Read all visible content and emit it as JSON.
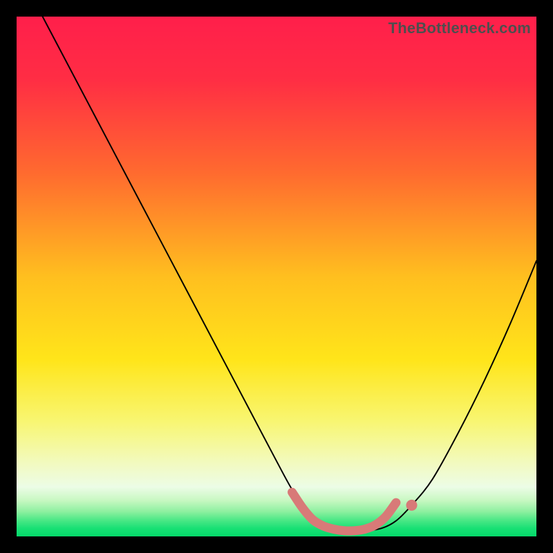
{
  "watermark": "TheBottleneck.com",
  "chart_data": {
    "type": "line",
    "title": "",
    "xlabel": "",
    "ylabel": "",
    "xlim": [
      0,
      100
    ],
    "ylim": [
      0,
      100
    ],
    "gradient_stops": [
      {
        "offset": 0.0,
        "color": "#ff1f4b"
      },
      {
        "offset": 0.12,
        "color": "#ff2d44"
      },
      {
        "offset": 0.3,
        "color": "#ff6a2f"
      },
      {
        "offset": 0.5,
        "color": "#ffbf1f"
      },
      {
        "offset": 0.66,
        "color": "#ffe51a"
      },
      {
        "offset": 0.78,
        "color": "#f8f673"
      },
      {
        "offset": 0.86,
        "color": "#f2fac0"
      },
      {
        "offset": 0.905,
        "color": "#ecfce6"
      },
      {
        "offset": 0.93,
        "color": "#c9f8c3"
      },
      {
        "offset": 0.952,
        "color": "#8ef0a0"
      },
      {
        "offset": 0.968,
        "color": "#4ee887"
      },
      {
        "offset": 0.985,
        "color": "#17e074"
      },
      {
        "offset": 1.0,
        "color": "#05d96a"
      }
    ],
    "series": [
      {
        "name": "bottleneck-curve",
        "x": [
          5,
          10,
          15,
          20,
          25,
          30,
          35,
          40,
          45,
          50,
          53,
          56,
          58,
          60,
          63,
          66,
          70,
          73,
          76,
          80,
          85,
          90,
          95,
          100
        ],
        "y": [
          100,
          90.5,
          81,
          71.5,
          62,
          52.5,
          43,
          33.5,
          24,
          14.5,
          9,
          4.5,
          2.5,
          1.5,
          1,
          1,
          1.5,
          3,
          6,
          11,
          20,
          30,
          41,
          53
        ]
      }
    ],
    "flat_region_marker": {
      "color": "#d87a78",
      "points_x": [
        53,
        55,
        57,
        59,
        61,
        63,
        65,
        67,
        69,
        71,
        73
      ],
      "points_y": [
        8.5,
        5.5,
        3.2,
        2.0,
        1.4,
        1.1,
        1.1,
        1.4,
        2.2,
        3.8,
        6.5
      ],
      "end_dot": {
        "x": 76,
        "y": 6
      }
    }
  }
}
